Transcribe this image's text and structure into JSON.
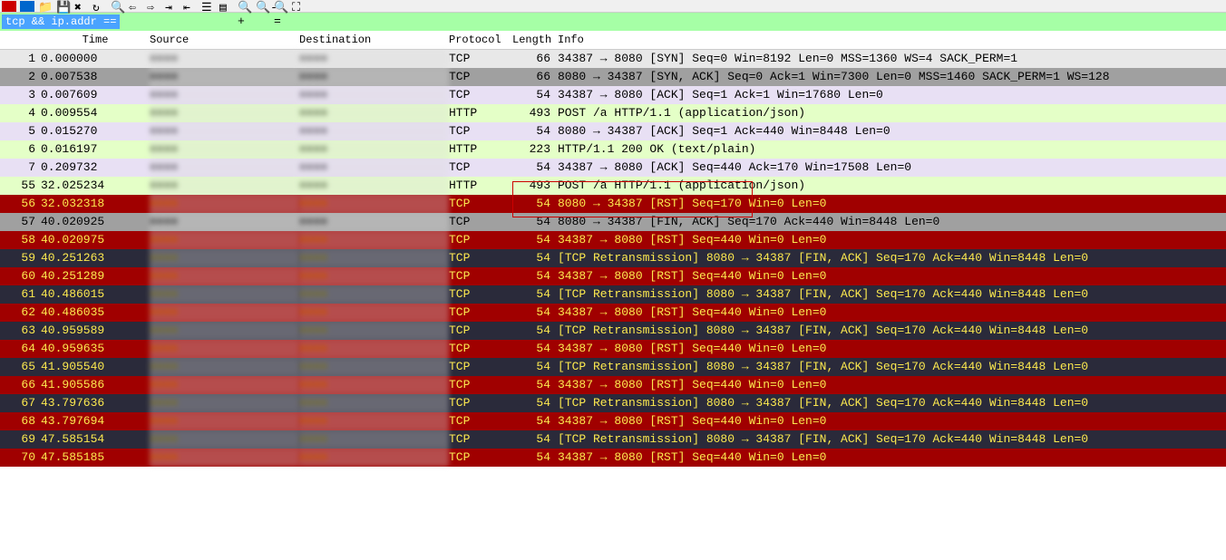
{
  "filter": {
    "text": "tcp && ip.addr =="
  },
  "headers": {
    "no": "",
    "time": "Time",
    "source": "Source",
    "destination": "Destination",
    "protocol": "Protocol",
    "length": "Length",
    "info": "Info"
  },
  "packets": [
    {
      "no": "1",
      "time": "0.000000",
      "proto": "TCP",
      "len": "66",
      "info": "34387 → 8080 [SYN] Seq=0 Win=8192 Len=0 MSS=1360 WS=4 SACK_PERM=1",
      "cls": "bg-gray"
    },
    {
      "no": "2",
      "time": "0.007538",
      "proto": "TCP",
      "len": "66",
      "info": "8080 → 34387 [SYN, ACK] Seq=0 Ack=1 Win=7300 Len=0 MSS=1460 SACK_PERM=1 WS=128",
      "cls": "bg-darkgray"
    },
    {
      "no": "3",
      "time": "0.007609",
      "proto": "TCP",
      "len": "54",
      "info": "34387 → 8080 [ACK] Seq=1 Ack=1 Win=17680 Len=0",
      "cls": "bg-lavender"
    },
    {
      "no": "4",
      "time": "0.009554",
      "proto": "HTTP",
      "len": "493",
      "info": "POST /a                     HTTP/1.1  (application/json)",
      "cls": "bg-green"
    },
    {
      "no": "5",
      "time": "0.015270",
      "proto": "TCP",
      "len": "54",
      "info": "8080 → 34387 [ACK] Seq=1 Ack=440 Win=8448 Len=0",
      "cls": "bg-lavender"
    },
    {
      "no": "6",
      "time": "0.016197",
      "proto": "HTTP",
      "len": "223",
      "info": "HTTP/1.1 200 OK  (text/plain)",
      "cls": "bg-green"
    },
    {
      "no": "7",
      "time": "0.209732",
      "proto": "TCP",
      "len": "54",
      "info": "34387 → 8080 [ACK] Seq=440 Ack=170 Win=17508 Len=0",
      "cls": "bg-lavender"
    },
    {
      "no": "55",
      "time": "32.025234",
      "proto": "HTTP",
      "len": "493",
      "info": "POST /a                    HTTP/1.1  (application/json)",
      "cls": "bg-green"
    },
    {
      "no": "56",
      "time": "32.032318",
      "proto": "TCP",
      "len": "54",
      "info": "8080 → 34387 [RST] Seq=170 Win=0 Len=0",
      "cls": "bg-red"
    },
    {
      "no": "57",
      "time": "40.020925",
      "proto": "TCP",
      "len": "54",
      "info": "8080 → 34387 [FIN, ACK] Seq=170 Ack=440 Win=8448 Len=0",
      "cls": "bg-darkgray"
    },
    {
      "no": "58",
      "time": "40.020975",
      "proto": "TCP",
      "len": "54",
      "info": "34387 → 8080 [RST] Seq=440 Win=0 Len=0",
      "cls": "bg-red"
    },
    {
      "no": "59",
      "time": "40.251263",
      "proto": "TCP",
      "len": "54",
      "info": "[TCP Retransmission] 8080 → 34387 [FIN, ACK] Seq=170 Ack=440 Win=8448 Len=0",
      "cls": "bg-darknavy"
    },
    {
      "no": "60",
      "time": "40.251289",
      "proto": "TCP",
      "len": "54",
      "info": "34387 → 8080 [RST] Seq=440 Win=0 Len=0",
      "cls": "bg-red"
    },
    {
      "no": "61",
      "time": "40.486015",
      "proto": "TCP",
      "len": "54",
      "info": "[TCP Retransmission] 8080 → 34387 [FIN, ACK] Seq=170 Ack=440 Win=8448 Len=0",
      "cls": "bg-darknavy"
    },
    {
      "no": "62",
      "time": "40.486035",
      "proto": "TCP",
      "len": "54",
      "info": "34387 → 8080 [RST] Seq=440 Win=0 Len=0",
      "cls": "bg-red"
    },
    {
      "no": "63",
      "time": "40.959589",
      "proto": "TCP",
      "len": "54",
      "info": "[TCP Retransmission] 8080 → 34387 [FIN, ACK] Seq=170 Ack=440 Win=8448 Len=0",
      "cls": "bg-darknavy"
    },
    {
      "no": "64",
      "time": "40.959635",
      "proto": "TCP",
      "len": "54",
      "info": "34387 → 8080 [RST] Seq=440 Win=0 Len=0",
      "cls": "bg-red"
    },
    {
      "no": "65",
      "time": "41.905540",
      "proto": "TCP",
      "len": "54",
      "info": "[TCP Retransmission] 8080 → 34387 [FIN, ACK] Seq=170 Ack=440 Win=8448 Len=0",
      "cls": "bg-darknavy"
    },
    {
      "no": "66",
      "time": "41.905586",
      "proto": "TCP",
      "len": "54",
      "info": "34387 → 8080 [RST] Seq=440 Win=0 Len=0",
      "cls": "bg-red"
    },
    {
      "no": "67",
      "time": "43.797636",
      "proto": "TCP",
      "len": "54",
      "info": "[TCP Retransmission] 8080 → 34387 [FIN, ACK] Seq=170 Ack=440 Win=8448 Len=0",
      "cls": "bg-darknavy"
    },
    {
      "no": "68",
      "time": "43.797694",
      "proto": "TCP",
      "len": "54",
      "info": "34387 → 8080 [RST] Seq=440 Win=0 Len=0",
      "cls": "bg-red"
    },
    {
      "no": "69",
      "time": "47.585154",
      "proto": "TCP",
      "len": "54",
      "info": "[TCP Retransmission] 8080 → 34387 [FIN, ACK] Seq=170 Ack=440 Win=8448 Len=0",
      "cls": "bg-darknavy"
    },
    {
      "no": "70",
      "time": "47.585185",
      "proto": "TCP",
      "len": "54",
      "info": "34387 → 8080 [RST] Seq=440 Win=0 Len=0",
      "cls": "bg-red"
    }
  ]
}
